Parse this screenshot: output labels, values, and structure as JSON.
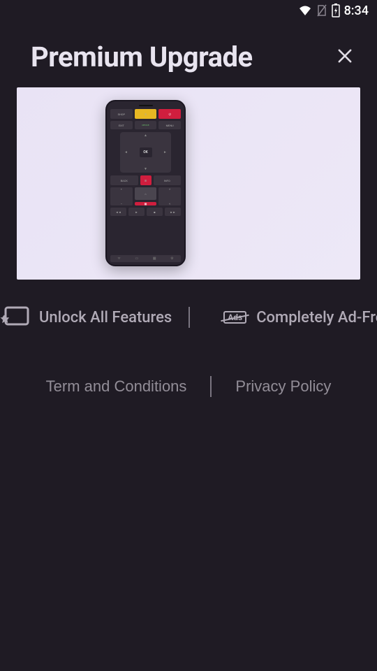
{
  "status": {
    "time": "8:34"
  },
  "header": {
    "title": "Premium Upgrade"
  },
  "hero": {
    "phone": {
      "ok_label": "OK",
      "ads_label": "Ads"
    }
  },
  "features": {
    "unlock": "Unlock All Features",
    "adfree": "Completely Ad-Free",
    "ads_badge": "Ads"
  },
  "links": {
    "terms": "Term and Conditions",
    "privacy": "Privacy Policy"
  }
}
